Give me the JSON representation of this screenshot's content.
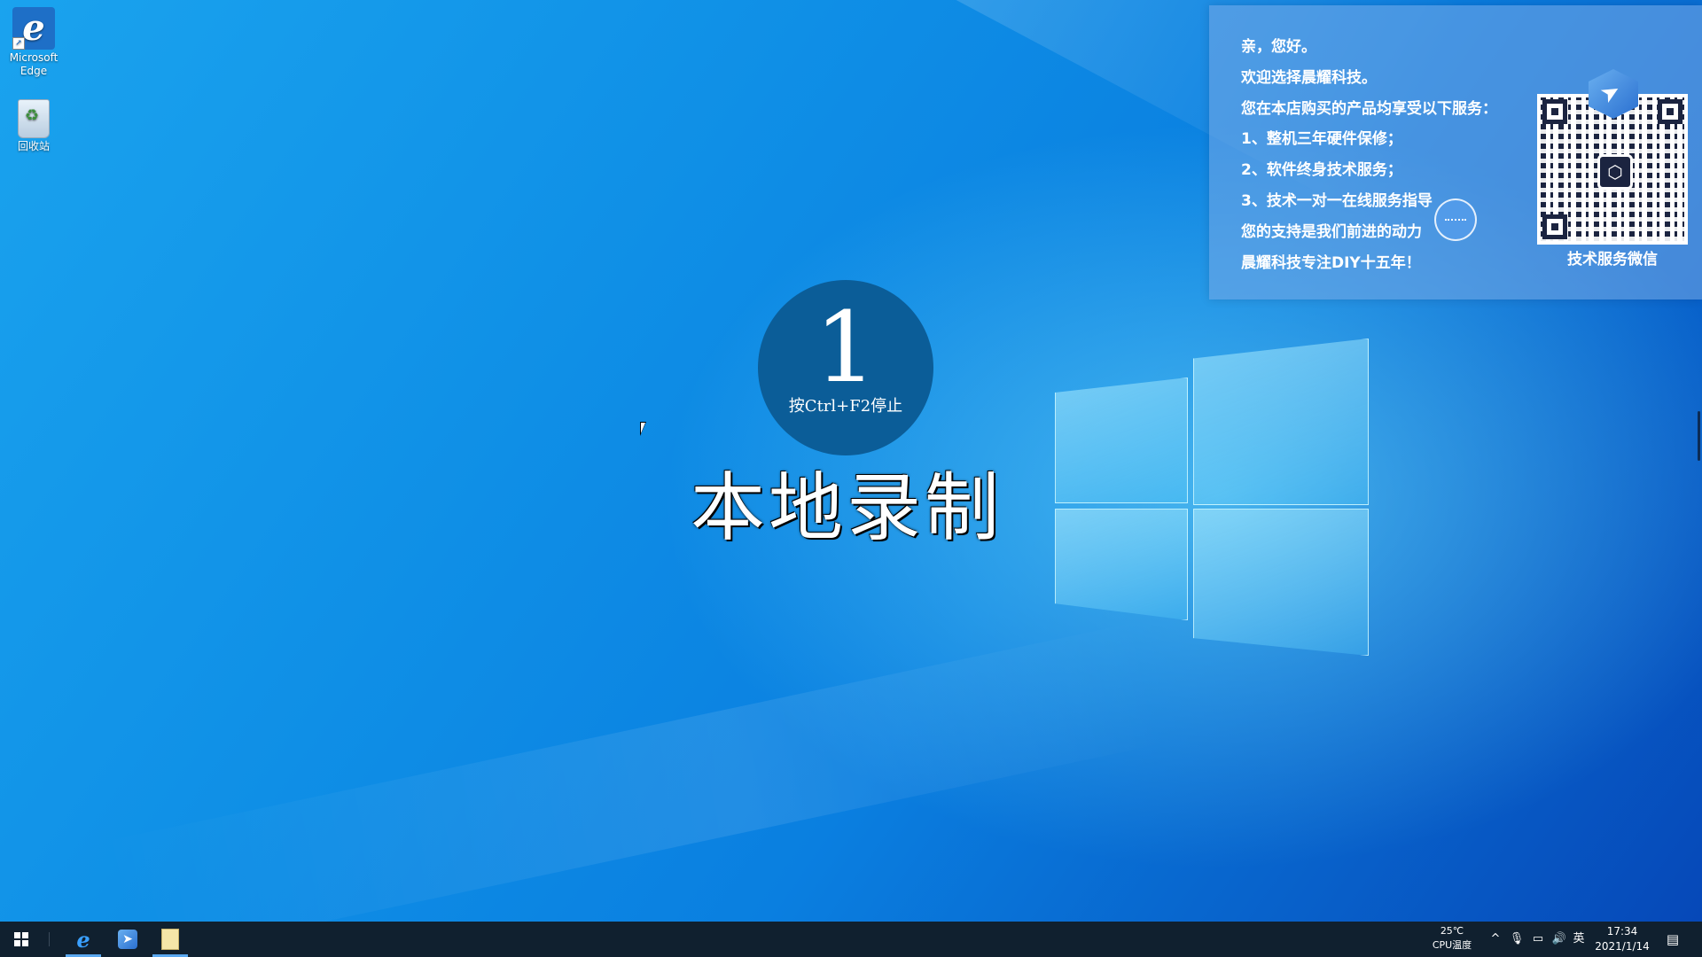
{
  "desktop": {
    "icons": [
      {
        "label": "Microsoft Edge",
        "icon": "edge-icon"
      },
      {
        "label": "回收站",
        "icon": "recycle-bin-icon"
      }
    ]
  },
  "recording": {
    "countdown": "1",
    "hint": "按Ctrl+F2停止",
    "title": "本地录制"
  },
  "service_panel": {
    "lines": [
      "亲，您好。",
      "欢迎选择晨耀科技。",
      "您在本店购买的产品均享受以下服务：",
      "1、整机三年硬件保修；",
      "2、软件终身技术服务；",
      "3、技术一对一在线服务指导",
      "您的支持是我们前进的动力",
      "晨耀科技专注DIY十五年！"
    ],
    "qr_caption": "技术服务微信"
  },
  "taskbar": {
    "apps": [
      {
        "icon": "edge-icon",
        "active": true
      },
      {
        "icon": "bird-app-icon",
        "active": false
      },
      {
        "icon": "notes-icon",
        "active": true
      }
    ],
    "cpu_temp_value": "25℃",
    "cpu_temp_label": "CPU温度",
    "ime": "英",
    "time": "17:34",
    "date": "2021/1/14"
  },
  "colors": {
    "desktop_blue": "#0f8fe6",
    "taskbar_bg": "#10202f",
    "rec_circle": "#0b5d98"
  }
}
